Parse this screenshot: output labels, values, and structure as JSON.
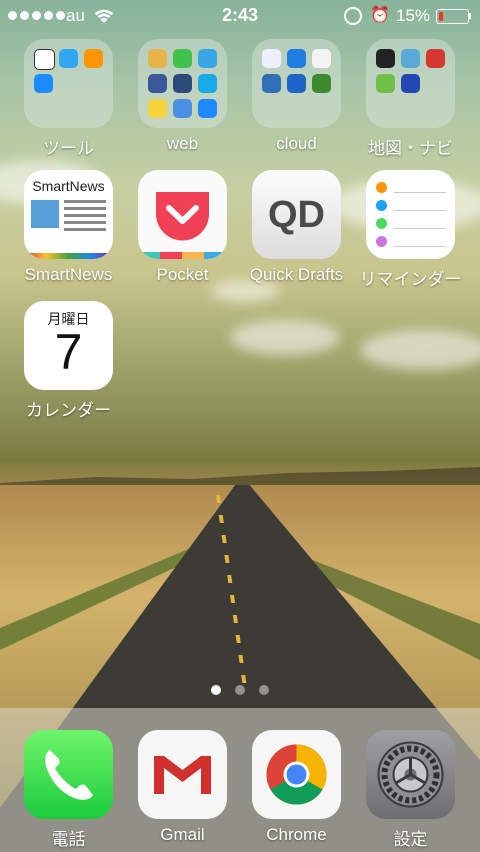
{
  "status_bar": {
    "carrier": "au",
    "time": "2:43",
    "battery_percent": "15%",
    "battery_level": 0.15,
    "icons": [
      "signal-dots-icon",
      "wifi-icon",
      "rotation-lock-icon",
      "alarm-icon",
      "battery-icon"
    ]
  },
  "home": {
    "row1": [
      {
        "label": "ツール",
        "icon": "folder-icon"
      },
      {
        "label": "web",
        "icon": "folder-icon"
      },
      {
        "label": "cloud",
        "icon": "folder-icon"
      },
      {
        "label": "地図・ナビ",
        "icon": "folder-icon"
      }
    ],
    "row2": [
      {
        "label": "SmartNews",
        "icon": "smartnews-icon",
        "tile_text": "SmartNews"
      },
      {
        "label": "Pocket",
        "icon": "pocket-icon"
      },
      {
        "label": "Quick Drafts",
        "icon": "quick-drafts-icon",
        "tile_text": "QD"
      },
      {
        "label": "リマインダー",
        "icon": "reminders-icon"
      }
    ],
    "row3": [
      {
        "label": "カレンダー",
        "icon": "calendar-icon",
        "weekday": "月曜日",
        "day": "7"
      }
    ]
  },
  "page_indicator": {
    "pages": 3,
    "current": 1
  },
  "dock": [
    {
      "label": "電話",
      "icon": "phone-icon"
    },
    {
      "label": "Gmail",
      "icon": "gmail-icon"
    },
    {
      "label": "Chrome",
      "icon": "chrome-icon"
    },
    {
      "label": "設定",
      "icon": "settings-icon"
    }
  ],
  "colors": {
    "battery_low": "#ff2e2e",
    "pocket_red": "#ef4056",
    "phone_green": "#4cd964"
  }
}
